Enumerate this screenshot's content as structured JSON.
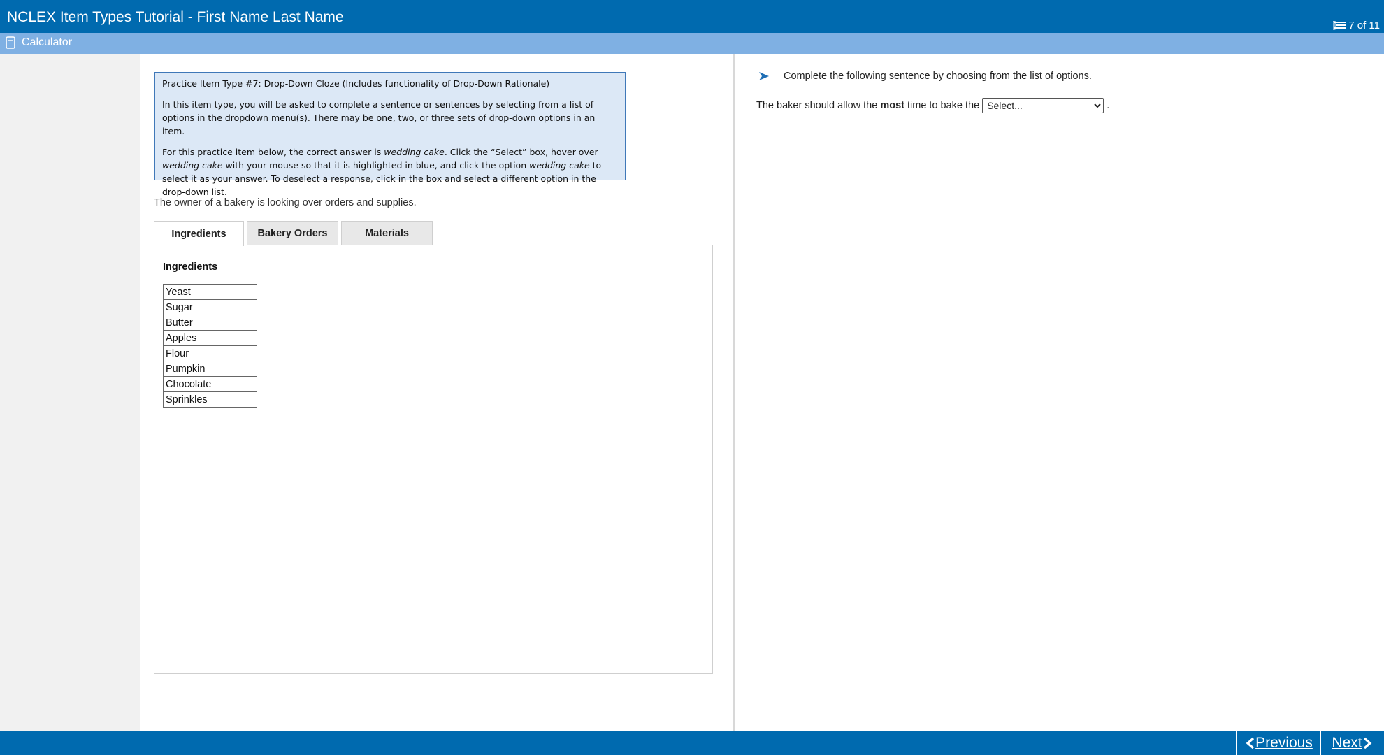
{
  "window": {
    "title": "NCLEX Item Types Tutorial - First Name Last Name",
    "progress": "7 of 11"
  },
  "toolbar": {
    "calculator_label": "Calculator"
  },
  "instructions": {
    "heading": "Practice Item Type #7: Drop-Down Cloze (Includes functionality of Drop-Down Rationale)",
    "para1": "In this item type, you will be asked to complete a sentence or sentences by selecting from a list of options in the dropdown menu(s). There may be one, two, or three sets of drop-down options in an item.",
    "para2": {
      "p1": "For this practice item below, the correct answer is ",
      "em1": "wedding cake",
      "p2": ". Click the “Select” box, hover over ",
      "em2": "wedding cake",
      "p3": " with your mouse so that it is highlighted in blue, and click the option ",
      "em3": "wedding cake",
      "p4": " to select it as your answer. To deselect a response, click in the box and select a different option in the drop-down list."
    }
  },
  "scenario": "The owner of a bakery is looking over orders and supplies.",
  "tabs": [
    {
      "label": "Ingredients"
    },
    {
      "label": "Bakery Orders"
    },
    {
      "label": "Materials"
    }
  ],
  "panel": {
    "heading": "Ingredients",
    "items": [
      "Yeast",
      "Sugar",
      "Butter",
      "Apples",
      "Flour",
      "Pumpkin",
      "Chocolate",
      "Sprinkles"
    ]
  },
  "question": {
    "prompt": "Complete the following sentence by choosing from the list of options.",
    "sentence_before": "The baker should allow the ",
    "sentence_bold": "most",
    "sentence_after": " time to bake the",
    "sentence_end": ".",
    "select_value": "Select..."
  },
  "nav": {
    "previous": "Previous",
    "next": "Next"
  },
  "colors": {
    "header": "#006aaf",
    "toolbar": "#7fb0e3",
    "instruction_bg": "#dce8f6"
  },
  "icons": {
    "calculator": "calculator-icon",
    "progress": "item-list-icon",
    "prompt": "arrow-pointer-icon",
    "previous": "chevron-left-icon",
    "next": "chevron-right-icon"
  }
}
